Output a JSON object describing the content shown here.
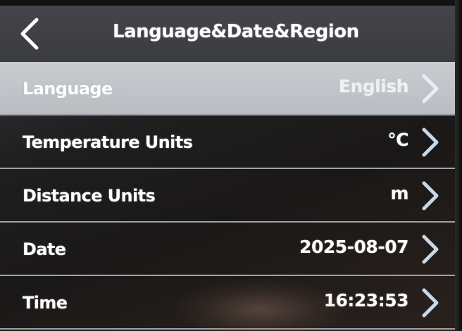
{
  "header": {
    "title": "Language&Date&Region",
    "back_icon": "chevron-left-icon"
  },
  "settings": {
    "rows": [
      {
        "label": "Language",
        "value": "English",
        "selected": true
      },
      {
        "label": "Temperature Units",
        "value": "℃",
        "selected": false
      },
      {
        "label": "Distance Units",
        "value": "m",
        "selected": false
      },
      {
        "label": "Date",
        "value": "2025-08-07",
        "selected": false
      },
      {
        "label": "Time",
        "value": "16:23:53",
        "selected": false
      }
    ],
    "row_icon": "chevron-right-icon"
  },
  "colors": {
    "header_bg": "#3e3f43",
    "selected_row_bg": "#c2c5c9",
    "divider": "#9ea3a8",
    "text": "#ffffff",
    "chevron": "#c8d8e6"
  }
}
